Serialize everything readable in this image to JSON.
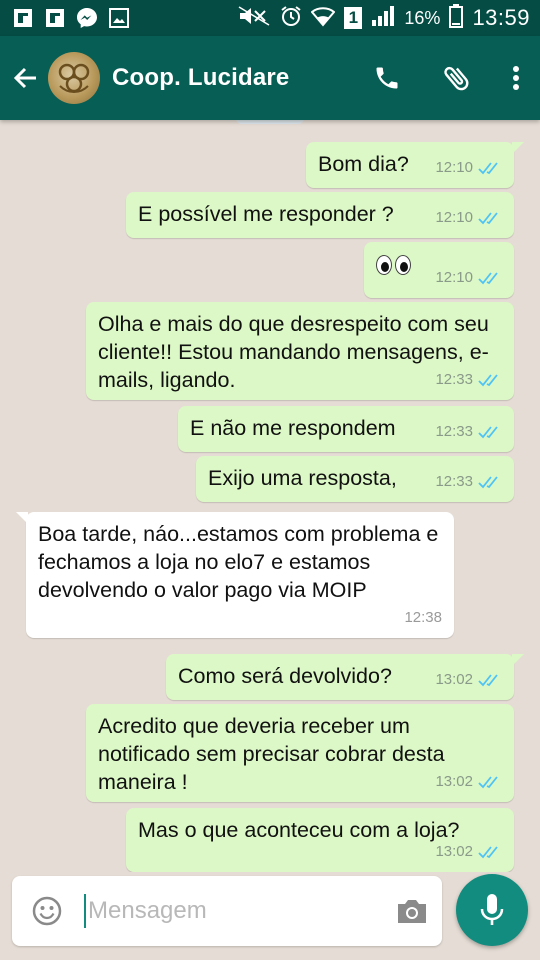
{
  "status_bar": {
    "battery_percent": "16%",
    "time": "13:59",
    "sim_slot": "1",
    "left_icons": [
      "flipboard-icon",
      "flipboard-icon",
      "messenger-icon",
      "image-icon"
    ],
    "right_icons": [
      "mute-icon",
      "alarm-icon",
      "wifi-icon",
      "signal-icon",
      "battery-icon"
    ]
  },
  "header": {
    "contact_name": "Coop. Lucidare",
    "icons": [
      "back-arrow-icon",
      "contact-avatar",
      "phone-icon",
      "attach-icon",
      "more-vert-icon"
    ]
  },
  "messages": [
    {
      "dir": "out",
      "text": "Bom dia?",
      "time": "12:10",
      "status": "read"
    },
    {
      "dir": "out",
      "text": "E possível me responder ?",
      "time": "12:10",
      "status": "read"
    },
    {
      "dir": "out",
      "text": "👀",
      "time": "12:10",
      "status": "read"
    },
    {
      "dir": "out",
      "text": "Olha e mais do que desrespeito com seu cliente!! Estou mandando mensagens, e-mails, ligando.",
      "time": "12:33",
      "status": "read"
    },
    {
      "dir": "out",
      "text": "E não me respondem",
      "time": "12:33",
      "status": "read"
    },
    {
      "dir": "out",
      "text": "Exijo uma resposta,",
      "time": "12:33",
      "status": "read"
    },
    {
      "dir": "in",
      "text": "Boa tarde, náo...estamos com problema e fechamos a loja no elo7 e estamos devolvendo o valor pago via MOIP",
      "time": "12:38"
    },
    {
      "dir": "out",
      "text": "Como será devolvido?",
      "time": "13:02",
      "status": "read"
    },
    {
      "dir": "out",
      "text": "Acredito que deveria receber um notificado sem precisar cobrar desta maneira !",
      "time": "13:02",
      "status": "read"
    },
    {
      "dir": "out",
      "text": "Mas o que aconteceu com a loja?",
      "time": "13:02",
      "status": "read"
    }
  ],
  "composer": {
    "placeholder": "Mensagem",
    "icons": [
      "emoji-icon",
      "camera-icon",
      "microphone-icon"
    ]
  },
  "colors": {
    "status_bar": "#054d44",
    "app_bar": "#075e54",
    "chat_background": "#e5ddd5",
    "outgoing_bubble": "#dcf8c6",
    "incoming_bubble": "#ffffff",
    "read_ticks": "#4fc3f7",
    "mic_button": "#128c7e"
  }
}
